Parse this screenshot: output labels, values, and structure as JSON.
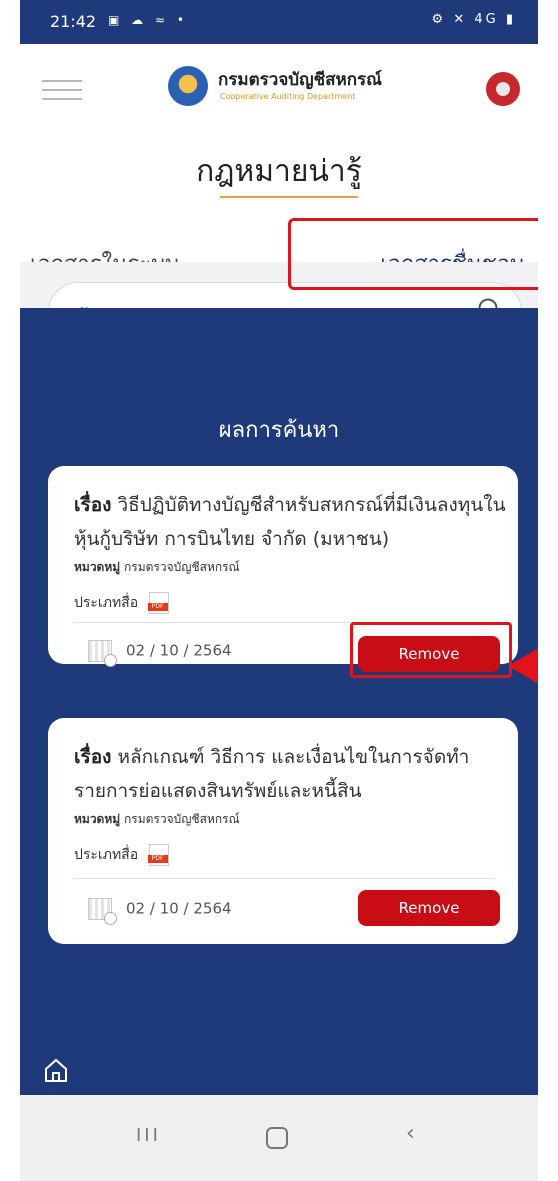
{
  "status_bar": {
    "time": "21:42",
    "left_icons": "▣ ☁ ≈ •",
    "right_icons": "⚙ ✕ 4G ▮"
  },
  "header": {
    "brand_name": "กรมตรวจบัญชีสหกรณ์",
    "brand_sub": "Cooperative Auditing Department"
  },
  "page_title": "กฎหมายน่ารู้",
  "tabs": {
    "left": "เอกสารในระบบ",
    "right": "เอกสารชื่นชอบ"
  },
  "search": {
    "placeholder": "ค้นหา"
  },
  "results_title": "ผลการค้นหา",
  "cards": [
    {
      "subject_label": "เรื่อง",
      "subject_text": "วิธีปฏิบัติทางบัญชีสำหรับสหกรณ์ที่มีเงินลงทุนในหุ้นกู้บริษัท การบินไทย จำกัด (มหาชน)",
      "category_label": "หมวดหมู่",
      "category_value": "กรมตรวจบัญชีสหกรณ์",
      "media_label": "ประเภทสื่อ",
      "media_icon": "PDF",
      "date": "02 / 10 / 2564",
      "remove_label": "Remove"
    },
    {
      "subject_label": "เรื่อง",
      "subject_text": "หลักเกณฑ์ วิธีการ และเงื่อนไขในการจัดทำรายการย่อแสดงสินทรัพย์และหนี้สิน",
      "category_label": "หมวดหมู่",
      "category_value": "กรมตรวจบัญชีสหกรณ์",
      "media_label": "ประเภทสื่อ",
      "media_icon": "PDF",
      "date": "02 / 10 / 2564",
      "remove_label": "Remove"
    }
  ],
  "colors": {
    "navy": "#1f3a7a",
    "remove": "#c80e14",
    "highlight": "#e0141a",
    "accent": "#e9a13b"
  },
  "icons": [
    "hamburger-icon",
    "logo-icon",
    "avatar-icon",
    "search-icon",
    "pdf-icon",
    "calendar-icon",
    "home-icon",
    "nav-recents-icon",
    "nav-home-icon",
    "nav-back-icon"
  ]
}
